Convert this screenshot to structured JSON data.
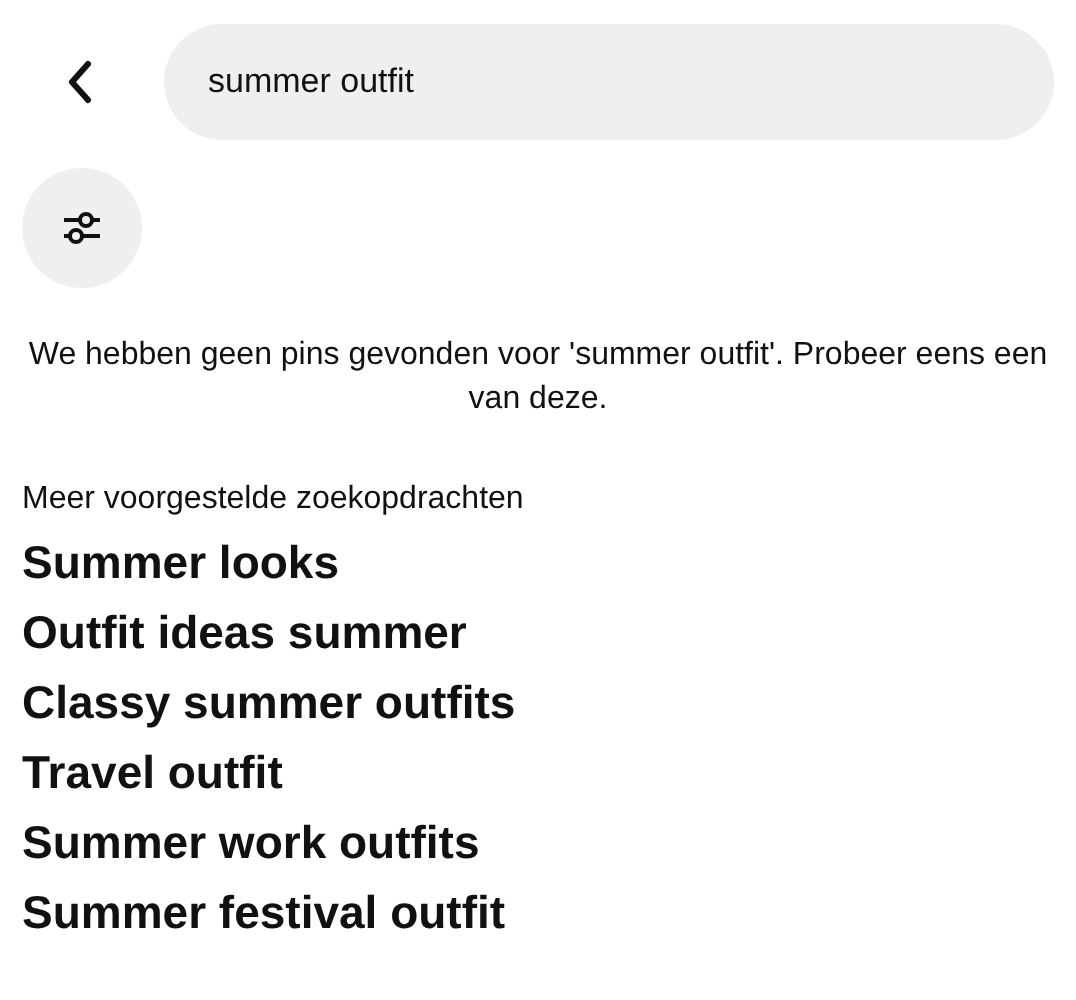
{
  "search": {
    "value": "summer outfit"
  },
  "message": "We hebben geen pins gevonden voor 'summer outfit'. Probeer eens een van deze.",
  "suggestions_heading": "Meer voorgestelde zoekopdrachten",
  "suggestions": [
    "Summer looks",
    "Outfit ideas summer",
    "Classy summer outfits",
    "Travel outfit",
    "Summer work outfits",
    "Summer festival outfit"
  ]
}
